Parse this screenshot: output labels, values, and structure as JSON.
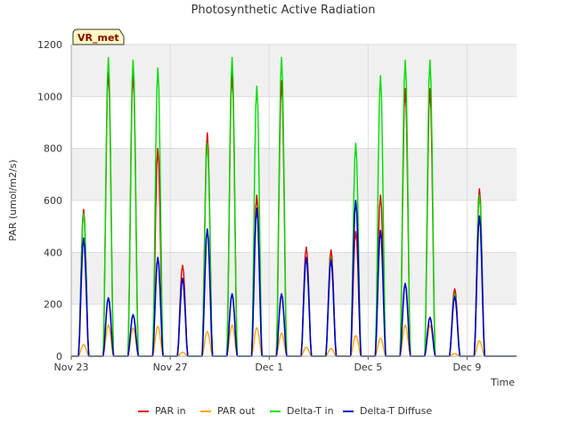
{
  "chart_data": {
    "type": "line",
    "title": "Photosynthetic Active Radiation",
    "xlabel": "Time",
    "ylabel": "PAR (umol/m2/s)",
    "badge": "VR_met",
    "ylim": [
      0,
      1200
    ],
    "yticks": [
      0,
      200,
      400,
      600,
      800,
      1000,
      1200
    ],
    "xlim": [
      "2023-11-23",
      "2023-12-11"
    ],
    "xticks": [
      {
        "label": "Nov 23",
        "date": "2023-11-23"
      },
      {
        "label": "Nov 27",
        "date": "2023-11-27"
      },
      {
        "label": "Dec 1",
        "date": "2023-12-01"
      },
      {
        "label": "Dec 5",
        "date": "2023-12-05"
      },
      {
        "label": "Dec 9",
        "date": "2023-12-09"
      }
    ],
    "grid": true,
    "legend": "bottom",
    "day_dates": [
      "2023-11-23",
      "2023-11-24",
      "2023-11-25",
      "2023-11-26",
      "2023-11-27",
      "2023-11-28",
      "2023-11-29",
      "2023-11-30",
      "2023-12-01",
      "2023-12-02",
      "2023-12-03",
      "2023-12-04",
      "2023-12-05",
      "2023-12-06",
      "2023-12-07",
      "2023-12-08",
      "2023-12-09",
      "2023-12-10"
    ],
    "series": [
      {
        "name": "PAR in",
        "color": "#dd0000",
        "daily_peaks": [
          565,
          1100,
          1090,
          800,
          350,
          860,
          1090,
          620,
          1060,
          420,
          410,
          480,
          620,
          1030,
          1030,
          260,
          645,
          0
        ]
      },
      {
        "name": "PAR out",
        "color": "#ffa500",
        "daily_peaks": [
          45,
          120,
          110,
          115,
          15,
          95,
          120,
          110,
          90,
          35,
          30,
          80,
          70,
          120,
          120,
          10,
          60,
          0
        ]
      },
      {
        "name": "Delta-T in",
        "color": "#00dd00",
        "daily_peaks": [
          550,
          1150,
          1140,
          1110,
          300,
          820,
          1150,
          1040,
          1150,
          380,
          380,
          820,
          1080,
          1140,
          1140,
          240,
          620,
          0
        ]
      },
      {
        "name": "Delta-T Diffuse",
        "color": "#0000cc",
        "daily_peaks": [
          455,
          225,
          160,
          380,
          300,
          490,
          240,
          570,
          240,
          380,
          370,
          600,
          485,
          280,
          150,
          230,
          540,
          0
        ]
      }
    ]
  }
}
